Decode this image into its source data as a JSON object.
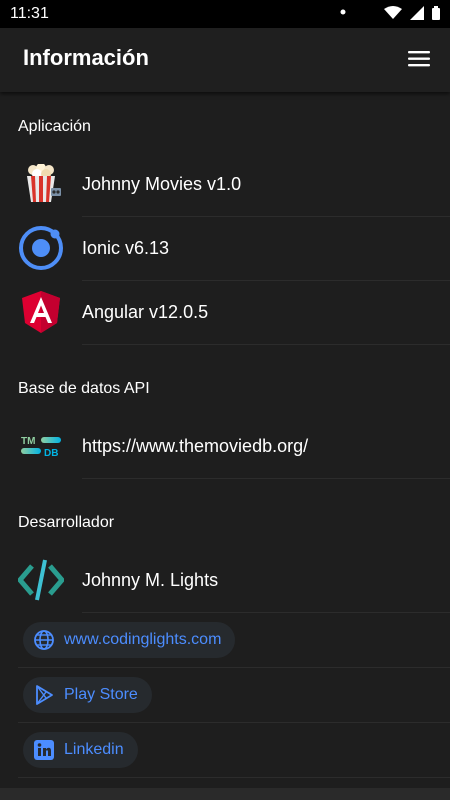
{
  "status_bar": {
    "time": "11:31"
  },
  "toolbar": {
    "title": "Información"
  },
  "sections": {
    "app": {
      "header": "Aplicación",
      "items": [
        {
          "label": "Johnny Movies v1.0",
          "icon": "popcorn-icon"
        },
        {
          "label": "Ionic v6.13",
          "icon": "ionic-icon"
        },
        {
          "label": "Angular v12.0.5",
          "icon": "angular-icon"
        }
      ]
    },
    "api": {
      "header": "Base de datos API",
      "items": [
        {
          "label": "https://www.themoviedb.org/",
          "icon": "tmdb-icon"
        }
      ]
    },
    "developer": {
      "header": "Desarrollador",
      "items": [
        {
          "label": "Johnny M. Lights",
          "icon": "code-icon"
        }
      ],
      "links": [
        {
          "label": "www.codinglights.com",
          "icon": "globe-icon"
        },
        {
          "label": "Play Store",
          "icon": "play-store-icon"
        },
        {
          "label": "Linkedin",
          "icon": "linkedin-icon"
        }
      ]
    }
  },
  "colors": {
    "background": "#1e1e1e",
    "link": "#4c8dff",
    "chip_bg": "#262a2e"
  }
}
